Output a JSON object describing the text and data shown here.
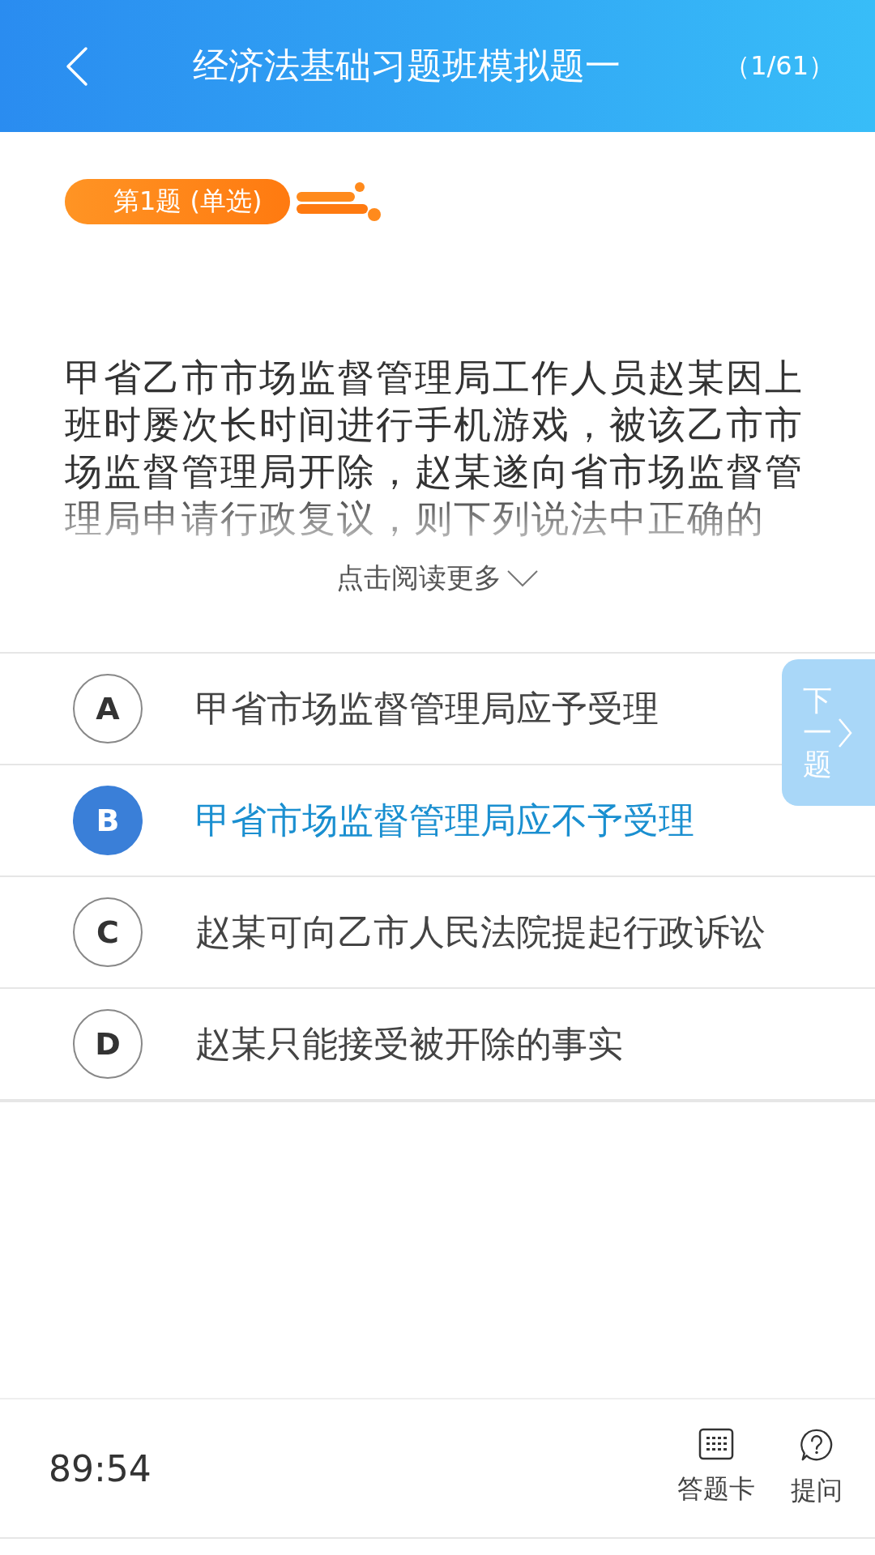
{
  "header": {
    "title": "经济法基础习题班模拟题一",
    "progress": "（1/61）"
  },
  "question": {
    "tag": "第1题 (单选)",
    "text": "甲省乙市市场监督管理局工作人员赵某因上班时屡次长时间进行手机游戏，被该乙市市场监督管理局开除，赵某遂向省市场监督管理局申请行政复议，则下列说法中正确的",
    "read_more": "点击阅读更多"
  },
  "options": [
    {
      "letter": "A",
      "text": "甲省市场监督管理局应予受理",
      "selected": false
    },
    {
      "letter": "B",
      "text": "甲省市场监督管理局应不予受理",
      "selected": true
    },
    {
      "letter": "C",
      "text": "赵某可向乙市人民法院提起行政诉讼",
      "selected": false
    },
    {
      "letter": "D",
      "text": "赵某只能接受被开除的事实",
      "selected": false
    }
  ],
  "next_button": {
    "label": "下一题"
  },
  "bottom_bar": {
    "timer": "89:54",
    "actions": [
      {
        "label": "答题卡",
        "kind": "card"
      },
      {
        "label": "提问",
        "kind": "ask"
      }
    ]
  }
}
